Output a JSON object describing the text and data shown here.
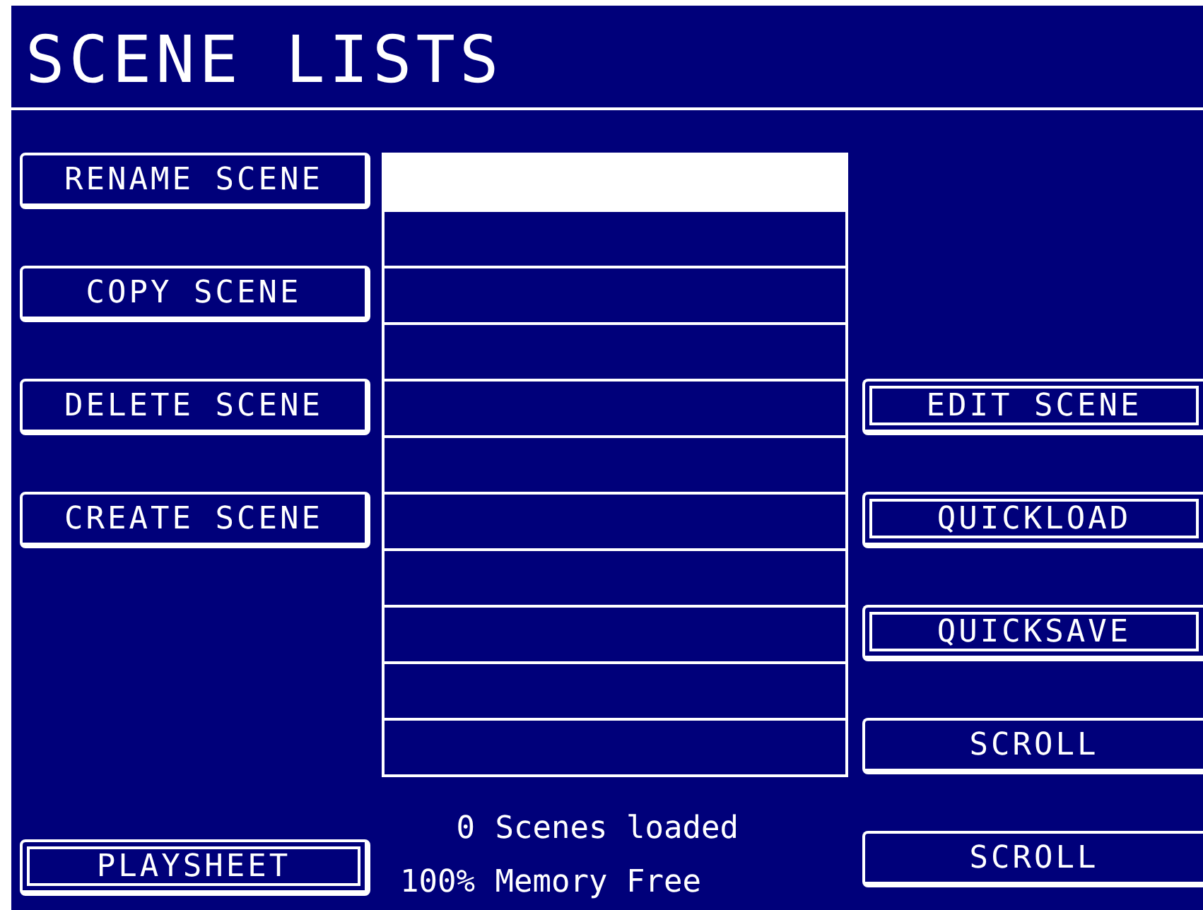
{
  "title": "SCENE LISTS",
  "left_buttons": [
    {
      "label": "RENAME SCENE",
      "kind": "single"
    },
    {
      "label": "COPY SCENE",
      "kind": "single"
    },
    {
      "label": "DELETE SCENE",
      "kind": "single"
    },
    {
      "label": "CREATE SCENE",
      "kind": "single"
    }
  ],
  "bottom_left_button": {
    "label": "PLAYSHEET",
    "kind": "double"
  },
  "scene_list": {
    "rows": [
      {
        "selected": true
      },
      {
        "selected": false
      },
      {
        "selected": false
      },
      {
        "selected": false
      },
      {
        "selected": false
      },
      {
        "selected": false
      },
      {
        "selected": false
      },
      {
        "selected": false
      },
      {
        "selected": false
      },
      {
        "selected": false
      },
      {
        "selected": false
      }
    ]
  },
  "status_lines": [
    {
      "figure": "0",
      "caption": "Scenes loaded"
    },
    {
      "figure": "100%",
      "caption": "Memory Free"
    }
  ],
  "right_buttons": [
    {
      "label": "EDIT SCENE",
      "kind": "double"
    },
    {
      "label": "QUICKLOAD",
      "kind": "double"
    },
    {
      "label": "QUICKSAVE",
      "kind": "double"
    },
    {
      "label": "SCROLL",
      "kind": "single"
    },
    {
      "label": "SCROLL",
      "kind": "single"
    }
  ]
}
